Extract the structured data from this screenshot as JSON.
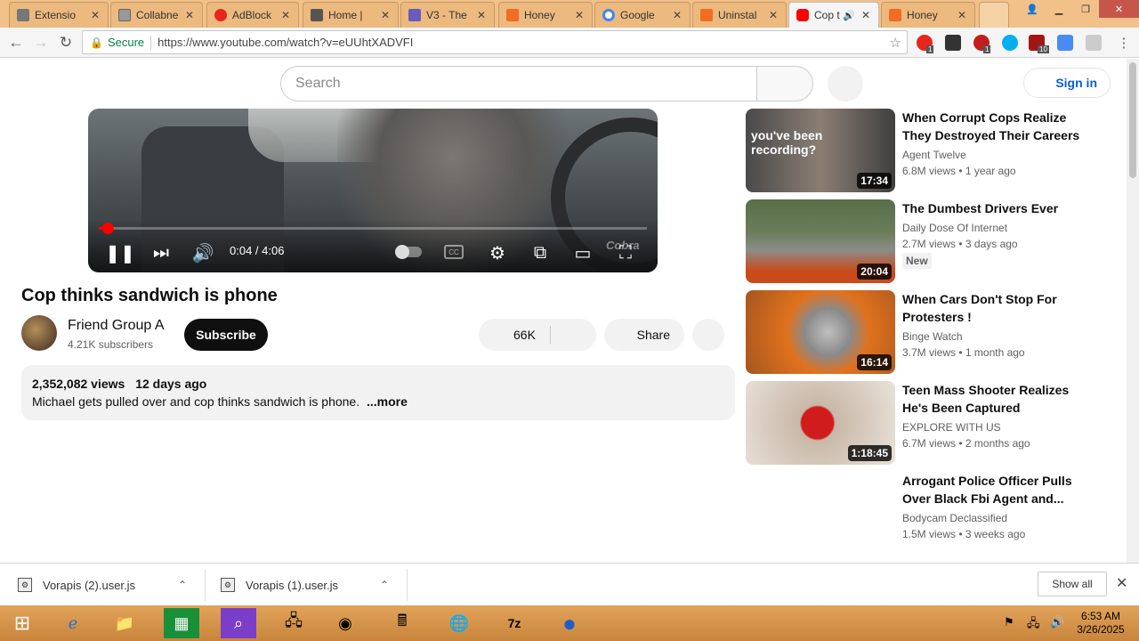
{
  "browser": {
    "tabs": [
      {
        "label": "Extensio",
        "favicon": "puzzle-icon",
        "color": "#666666"
      },
      {
        "label": "Collabne",
        "favicon": "page-icon",
        "color": "#888888"
      },
      {
        "label": "AdBlock",
        "favicon": "adblock-icon",
        "color": "#e8261d"
      },
      {
        "label": "Home | ",
        "favicon": "userscript-icon",
        "color": "#555555"
      },
      {
        "label": "V3 - The",
        "favicon": "v3-icon",
        "color": "#6b5bbf"
      },
      {
        "label": "Honey",
        "favicon": "honey-icon",
        "color": "#f26c21"
      },
      {
        "label": "Google",
        "favicon": "google-icon",
        "color": "#4285f4"
      },
      {
        "label": "Uninstal",
        "favicon": "honey-icon",
        "color": "#f26c21"
      },
      {
        "label": "Cop t",
        "favicon": "youtube-icon",
        "color": "#ff0000",
        "active": true
      },
      {
        "label": "Honey",
        "favicon": "honey-icon",
        "color": "#f26c21"
      }
    ],
    "secure_label": "Secure",
    "url": "https://www.youtube.com/watch?v=eUUhtXADVFI",
    "extension_badges": [
      "1",
      "1",
      "10"
    ]
  },
  "youtube": {
    "search_placeholder": "Search",
    "signin_label": "Sign in",
    "player": {
      "current_time": "0:04",
      "duration": "4:06",
      "time_display": "0:04 / 4:06",
      "progress_fraction": 0.016,
      "watermark": "Cobra"
    },
    "video": {
      "title": "Cop thinks sandwich is phone",
      "channel": "Friend Group A",
      "subscribers": "4.21K subscribers",
      "subscribe_label": "Subscribe",
      "likes": "66K",
      "share_label": "Share",
      "views": "2,352,082 views",
      "age": "12 days ago",
      "description": "Michael gets pulled over and cop thinks sandwich is phone.",
      "more_label": "...more"
    },
    "recommendations": [
      {
        "title": "When Corrupt Cops Realize They Destroyed Their Careers",
        "channel": "Agent Twelve",
        "stats": "6.8M views • 1 year ago",
        "duration": "17:34",
        "thumb_text": "you've been recording?"
      },
      {
        "title": "The Dumbest Drivers Ever",
        "channel": "Daily Dose Of Internet",
        "stats": "2.7M views • 3 days ago",
        "duration": "20:04",
        "badge": "New"
      },
      {
        "title": "When Cars Don't Stop For Protesters !",
        "channel": "Binge Watch",
        "stats": "3.7M views • 1 month ago",
        "duration": "16:14"
      },
      {
        "title": "Teen Mass Shooter Realizes He's Been Captured",
        "channel": "EXPLORE WITH US",
        "stats": "6.7M views • 2 months ago",
        "duration": "1:18:45"
      },
      {
        "title": "Arrogant Police Officer Pulls Over Black Fbi Agent and...",
        "channel": "Bodycam Declassified",
        "stats": "1.5M views • 3 weeks ago"
      }
    ]
  },
  "downloads": {
    "items": [
      "Vorapis (2).user.js",
      "Vorapis (1).user.js"
    ],
    "show_all_label": "Show all"
  },
  "taskbar": {
    "time": "6:53 AM",
    "date": "3/26/2025"
  }
}
